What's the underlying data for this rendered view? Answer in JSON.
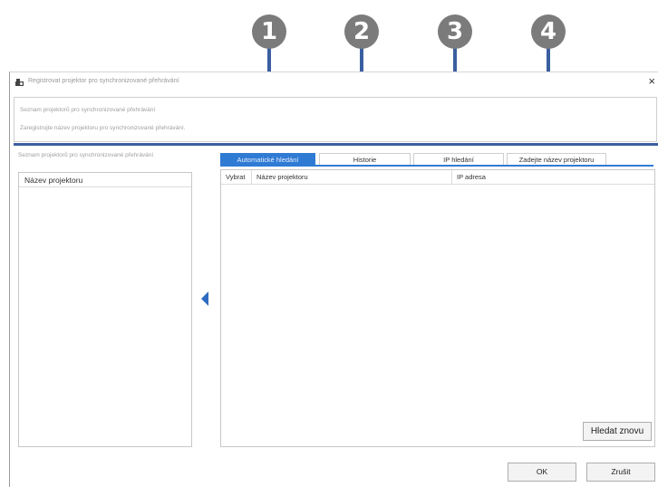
{
  "callouts": [
    "1",
    "2",
    "3",
    "4"
  ],
  "window": {
    "title": "Registrovat projektor pro synchronizované přehrávání",
    "close_label": "×",
    "icon": "projector-app-icon"
  },
  "header": {
    "line1": "Seznam projektorů pro synchronizované přehrávání",
    "line2": "Zaregistrujte název projektoru pro synchronizované přehrávání."
  },
  "left_panel": {
    "caption": "Seznam projektorů pro synchronizované přehrávání",
    "column_header": "Název projektoru"
  },
  "tabs": [
    {
      "label": "Automatické hledání",
      "active": true
    },
    {
      "label": "Historie",
      "active": false
    },
    {
      "label": "IP hledání",
      "active": false
    },
    {
      "label": "Zadejte název projektoru",
      "active": false
    }
  ],
  "table": {
    "columns": [
      "Vybrat",
      "Název projektoru",
      "IP adresa"
    ],
    "rows": []
  },
  "buttons": {
    "search_again": "Hledat znovu",
    "ok": "OK",
    "cancel": "Zrušit"
  },
  "colors": {
    "accent": "#2f7bd4",
    "callout_line": "#3a5fa0",
    "badge": "#7b7b7b"
  }
}
